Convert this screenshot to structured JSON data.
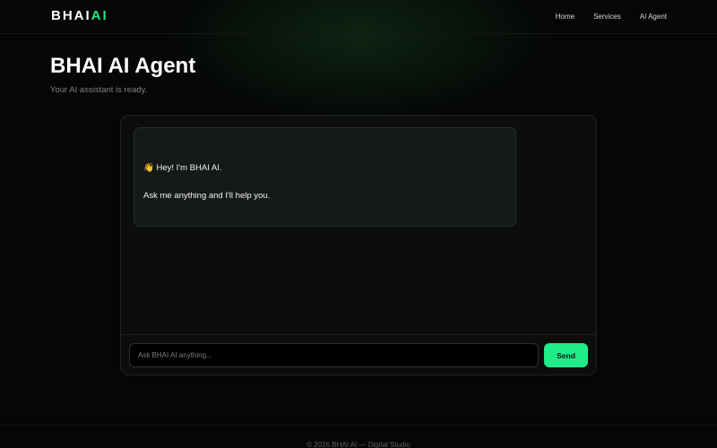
{
  "header": {
    "logo_part1": "BHAI",
    "logo_part2": "AI",
    "nav": [
      {
        "label": "Home"
      },
      {
        "label": "Services"
      },
      {
        "label": "AI Agent"
      }
    ]
  },
  "hero": {
    "title": "BHAI AI Agent",
    "subtitle": "Your AI assistant is ready."
  },
  "chat": {
    "messages": [
      {
        "sender": "assistant",
        "line1": "👋 Hey! I'm BHAI AI.",
        "line2": "Ask me anything and I'll help you."
      }
    ],
    "input": {
      "placeholder": "Ask BHAI AI anything...",
      "value": ""
    },
    "send_label": "Send"
  },
  "footer": {
    "text": "© 2026 BHAI AI — Digital Studio"
  },
  "colors": {
    "accent": "#22e584",
    "background": "#050605",
    "panel": "#0c0e0c"
  }
}
